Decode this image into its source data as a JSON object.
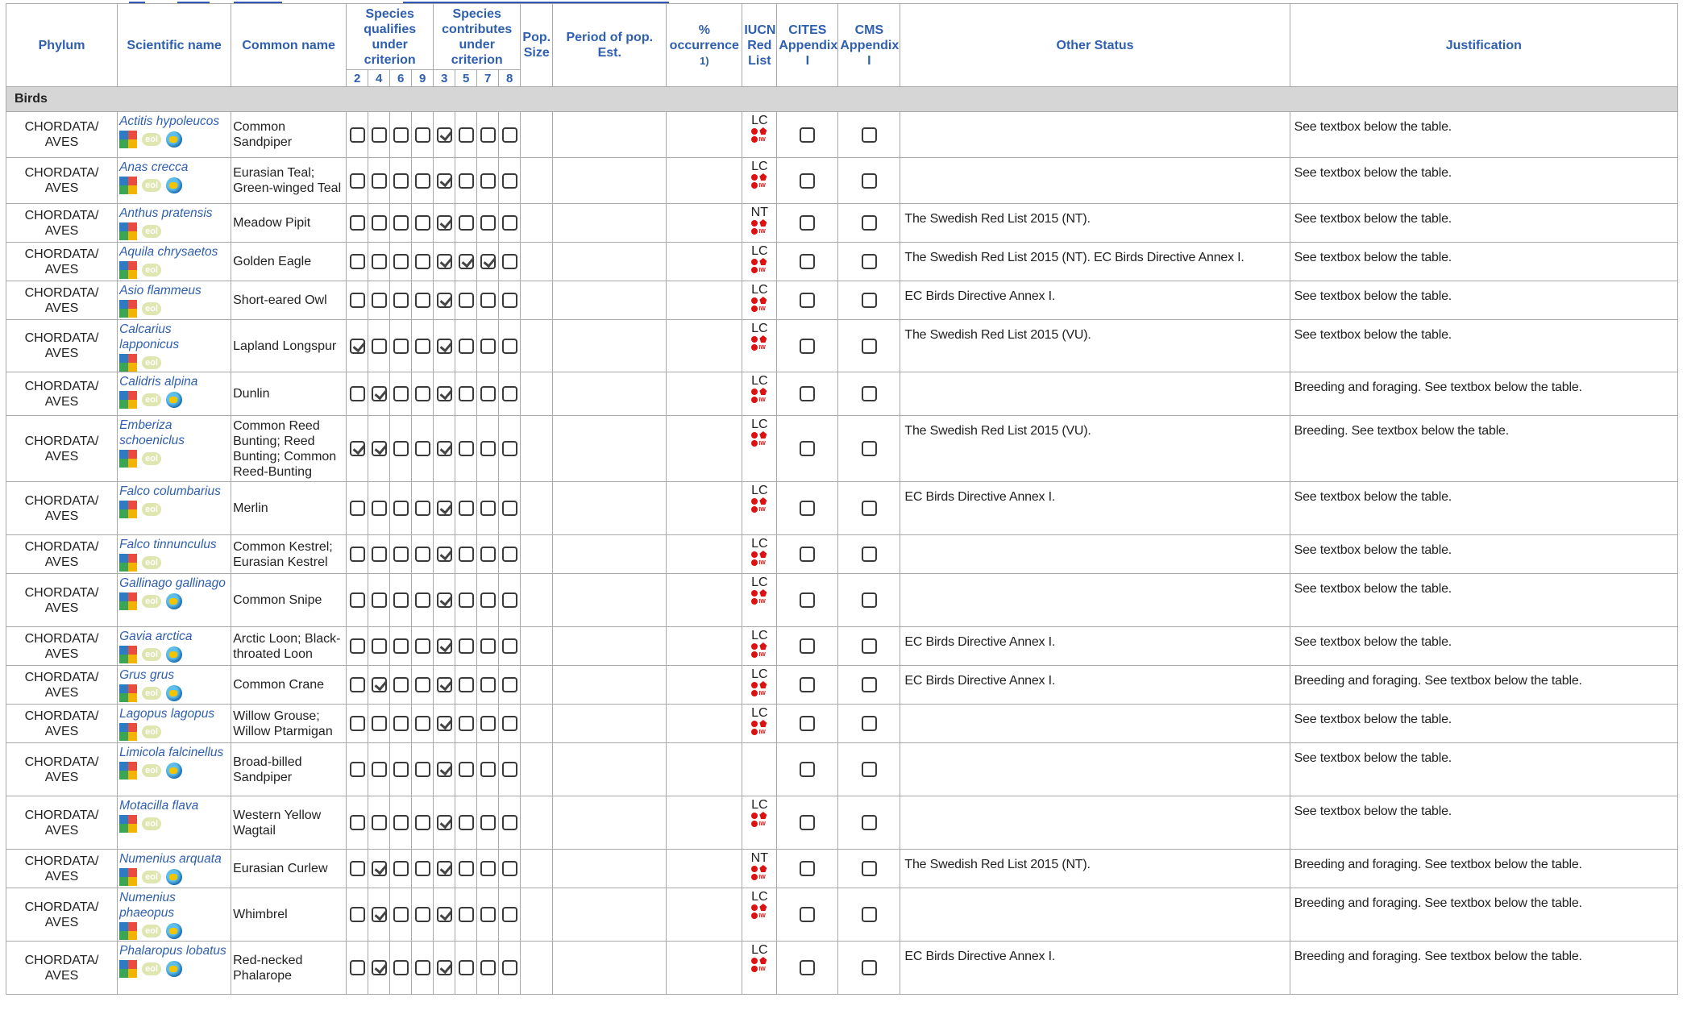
{
  "header": {
    "phylum": "Phylum",
    "scientific_name": "Scientific name",
    "common_name": "Common name",
    "qualifies": "Species qualifies under criterion",
    "contributes": "Species contributes under criterion",
    "pop_size": "Pop. Size",
    "period": "Period of pop. Est.",
    "occurrence": "% occurrence",
    "occurrence_note": "1)",
    "iucn": "IUCN Red List",
    "cites": "CITES Appendix I",
    "cms": "CMS Appendix I",
    "other_status": "Other Status",
    "justification": "Justification",
    "qualifies_criteria": [
      "2",
      "4",
      "6",
      "9"
    ],
    "contributes_criteria": [
      "3",
      "5",
      "7",
      "8"
    ]
  },
  "category": "Birds",
  "eol_label": "eol",
  "rows": [
    {
      "phylum": "CHORDATA/ AVES",
      "sci": "Actitis hypoleucos",
      "common": "Common Sandpiper",
      "q": [
        0,
        0,
        0,
        0
      ],
      "c": [
        1,
        0,
        0,
        0
      ],
      "iucn": "LC",
      "other": "",
      "just": "See textbox below the table.",
      "globe": true
    },
    {
      "phylum": "CHORDATA/ AVES",
      "sci": "Anas crecca",
      "common": "Eurasian Teal; Green-winged Teal",
      "q": [
        0,
        0,
        0,
        0
      ],
      "c": [
        1,
        0,
        0,
        0
      ],
      "iucn": "LC",
      "other": "",
      "just": "See textbox below the table.",
      "globe": true
    },
    {
      "phylum": "CHORDATA/ AVES",
      "sci": "Anthus pratensis",
      "common": "Meadow Pipit",
      "q": [
        0,
        0,
        0,
        0
      ],
      "c": [
        1,
        0,
        0,
        0
      ],
      "iucn": "NT",
      "other": "The Swedish Red List 2015 (NT).",
      "just": "See textbox below the table.",
      "globe": false
    },
    {
      "phylum": "CHORDATA/ AVES",
      "sci": "Aquila chrysaetos",
      "common": "Golden Eagle",
      "q": [
        0,
        0,
        0,
        0
      ],
      "c": [
        1,
        1,
        1,
        0
      ],
      "iucn": "LC",
      "other": "The Swedish Red List 2015 (NT). EC Birds Directive Annex I.",
      "just": "See textbox below the table.",
      "globe": false
    },
    {
      "phylum": "CHORDATA/ AVES",
      "sci": "Asio flammeus",
      "common": "Short-eared Owl",
      "q": [
        0,
        0,
        0,
        0
      ],
      "c": [
        1,
        0,
        0,
        0
      ],
      "iucn": "LC",
      "other": "EC Birds Directive Annex I.",
      "just": "See textbox below the table.",
      "globe": false
    },
    {
      "phylum": "CHORDATA/ AVES",
      "sci": "Calcarius lapponicus",
      "common": "Lapland Longspur",
      "q": [
        1,
        0,
        0,
        0
      ],
      "c": [
        1,
        0,
        0,
        0
      ],
      "iucn": "LC",
      "other": "The Swedish Red List 2015 (VU).",
      "just": "See textbox below the table.",
      "globe": false
    },
    {
      "phylum": "CHORDATA/ AVES",
      "sci": "Calidris alpina",
      "common": "Dunlin",
      "q": [
        0,
        1,
        0,
        0
      ],
      "c": [
        1,
        0,
        0,
        0
      ],
      "iucn": "LC",
      "other": "",
      "just": "Breeding and foraging. See textbox below the table.",
      "globe": true
    },
    {
      "phylum": "CHORDATA/ AVES",
      "sci": "Emberiza schoeniclus",
      "common": "Common Reed Bunting; Reed Bunting; Common Reed-Bunting",
      "q": [
        1,
        1,
        0,
        0
      ],
      "c": [
        1,
        0,
        0,
        0
      ],
      "iucn": "LC",
      "other": "The Swedish Red List 2015 (VU).",
      "just": "Breeding. See textbox below the table.",
      "globe": false
    },
    {
      "phylum": "CHORDATA/ AVES",
      "sci": "Falco columbarius",
      "common": "Merlin",
      "q": [
        0,
        0,
        0,
        0
      ],
      "c": [
        1,
        0,
        0,
        0
      ],
      "iucn": "LC",
      "other": "EC Birds Directive Annex I.",
      "just": "See textbox below the table.",
      "globe": false
    },
    {
      "phylum": "CHORDATA/ AVES",
      "sci": "Falco tinnunculus",
      "common": "Common Kestrel; Eurasian Kestrel",
      "q": [
        0,
        0,
        0,
        0
      ],
      "c": [
        1,
        0,
        0,
        0
      ],
      "iucn": "LC",
      "other": "",
      "just": "See textbox below the table.",
      "globe": false
    },
    {
      "phylum": "CHORDATA/ AVES",
      "sci": "Gallinago gallinago",
      "common": "Common Snipe",
      "q": [
        0,
        0,
        0,
        0
      ],
      "c": [
        1,
        0,
        0,
        0
      ],
      "iucn": "LC",
      "other": "",
      "just": "See textbox below the table.",
      "globe": true
    },
    {
      "phylum": "CHORDATA/ AVES",
      "sci": "Gavia arctica",
      "common": "Arctic Loon; Black-throated Loon",
      "q": [
        0,
        0,
        0,
        0
      ],
      "c": [
        1,
        0,
        0,
        0
      ],
      "iucn": "LC",
      "other": "EC Birds Directive Annex I.",
      "just": "See textbox below the table.",
      "globe": true
    },
    {
      "phylum": "CHORDATA/ AVES",
      "sci": "Grus grus",
      "common": "Common Crane",
      "q": [
        0,
        1,
        0,
        0
      ],
      "c": [
        1,
        0,
        0,
        0
      ],
      "iucn": "LC",
      "other": "EC Birds Directive Annex I.",
      "just": "Breeding and foraging. See textbox below the table.",
      "globe": true
    },
    {
      "phylum": "CHORDATA/ AVES",
      "sci": "Lagopus lagopus",
      "common": "Willow Grouse; Willow Ptarmigan",
      "q": [
        0,
        0,
        0,
        0
      ],
      "c": [
        1,
        0,
        0,
        0
      ],
      "iucn": "LC",
      "other": "",
      "just": "See textbox below the table.",
      "globe": false
    },
    {
      "phylum": "CHORDATA/ AVES",
      "sci": "Limicola falcinellus",
      "common": "Broad-billed Sandpiper",
      "q": [
        0,
        0,
        0,
        0
      ],
      "c": [
        1,
        0,
        0,
        0
      ],
      "iucn": "",
      "other": "",
      "just": "See textbox below the table.",
      "globe": true
    },
    {
      "phylum": "CHORDATA/ AVES",
      "sci": "Motacilla flava",
      "common": "Western Yellow Wagtail",
      "q": [
        0,
        0,
        0,
        0
      ],
      "c": [
        1,
        0,
        0,
        0
      ],
      "iucn": "LC",
      "other": "",
      "just": "See textbox below the table.",
      "globe": false
    },
    {
      "phylum": "CHORDATA/ AVES",
      "sci": "Numenius arquata",
      "common": "Eurasian Curlew",
      "q": [
        0,
        1,
        0,
        0
      ],
      "c": [
        1,
        0,
        0,
        0
      ],
      "iucn": "NT",
      "other": "The Swedish Red List 2015 (NT).",
      "just": "Breeding and foraging. See textbox below the table.",
      "globe": true
    },
    {
      "phylum": "CHORDATA/ AVES",
      "sci": "Numenius phaeopus",
      "common": "Whimbrel",
      "q": [
        0,
        1,
        0,
        0
      ],
      "c": [
        1,
        0,
        0,
        0
      ],
      "iucn": "LC",
      "other": "",
      "just": "Breeding and foraging. See textbox below the table.",
      "globe": true
    },
    {
      "phylum": "CHORDATA/ AVES",
      "sci": "Phalaropus lobatus",
      "common": "Red-necked Phalarope",
      "q": [
        0,
        1,
        0,
        0
      ],
      "c": [
        1,
        0,
        0,
        0
      ],
      "iucn": "LC",
      "other": "EC Birds Directive Annex I.",
      "just": "Breeding and foraging. See textbox below the table.",
      "globe": true
    }
  ]
}
